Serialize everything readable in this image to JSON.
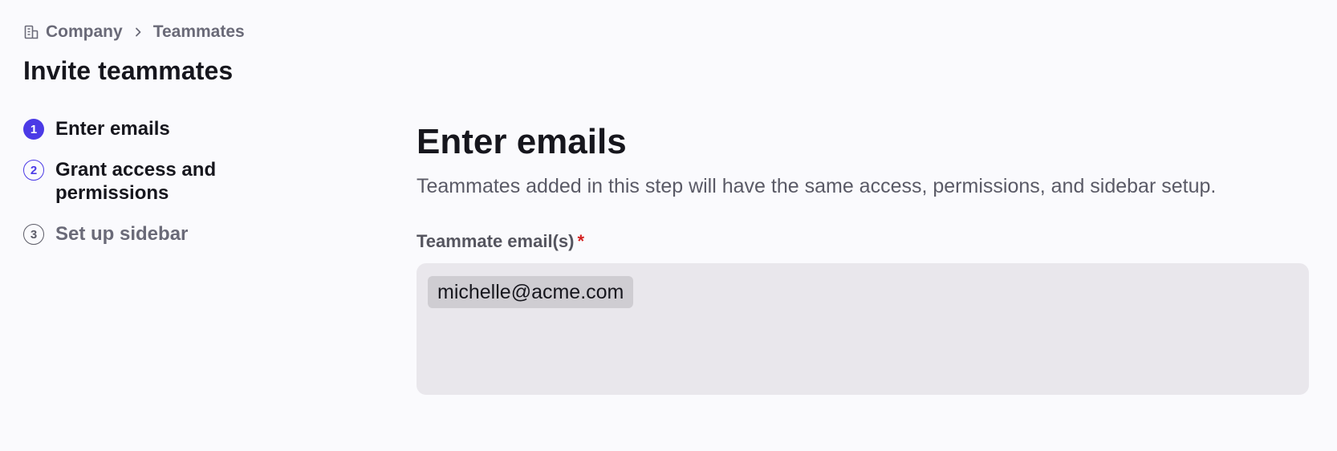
{
  "breadcrumb": {
    "items": [
      "Company",
      "Teammates"
    ],
    "icon": "building-icon",
    "separator_icon": "chevron-right-icon"
  },
  "page_title": "Invite teammates",
  "stepper": {
    "steps": [
      {
        "number": "1",
        "label": "Enter emails",
        "state": "active"
      },
      {
        "number": "2",
        "label": "Grant access and permissions",
        "state": "upcoming"
      },
      {
        "number": "3",
        "label": "Set up sidebar",
        "state": "upcoming"
      }
    ]
  },
  "main": {
    "title": "Enter emails",
    "description": "Teammates added in this step will have the same access, permissions, and sidebar setup.",
    "field_label": "Teammate email(s)",
    "required_mark": "*",
    "emails": [
      "michelle@acme.com"
    ]
  },
  "colors": {
    "accent": "#4b3ae6",
    "required": "#d42020",
    "background": "#fafafd",
    "input_background": "#e9e7ec"
  }
}
